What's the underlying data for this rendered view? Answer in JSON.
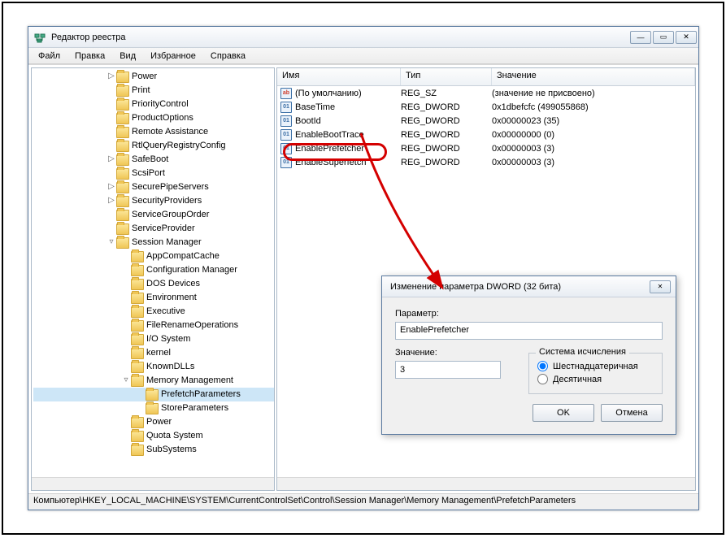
{
  "window": {
    "title": "Редактор реестра",
    "menu": [
      "Файл",
      "Правка",
      "Вид",
      "Избранное",
      "Справка"
    ],
    "btn_min": "—",
    "btn_max": "▭",
    "btn_close": "✕"
  },
  "tree": [
    {
      "ind": 90,
      "exp": "▷",
      "label": "Power"
    },
    {
      "ind": 90,
      "exp": "",
      "label": "Print"
    },
    {
      "ind": 90,
      "exp": "",
      "label": "PriorityControl"
    },
    {
      "ind": 90,
      "exp": "",
      "label": "ProductOptions"
    },
    {
      "ind": 90,
      "exp": "",
      "label": "Remote Assistance"
    },
    {
      "ind": 90,
      "exp": "",
      "label": "RtlQueryRegistryConfig"
    },
    {
      "ind": 90,
      "exp": "▷",
      "label": "SafeBoot"
    },
    {
      "ind": 90,
      "exp": "",
      "label": "ScsiPort"
    },
    {
      "ind": 90,
      "exp": "▷",
      "label": "SecurePipeServers"
    },
    {
      "ind": 90,
      "exp": "▷",
      "label": "SecurityProviders"
    },
    {
      "ind": 90,
      "exp": "",
      "label": "ServiceGroupOrder"
    },
    {
      "ind": 90,
      "exp": "",
      "label": "ServiceProvider"
    },
    {
      "ind": 90,
      "exp": "▿",
      "label": "Session Manager"
    },
    {
      "ind": 108,
      "exp": "",
      "label": "AppCompatCache"
    },
    {
      "ind": 108,
      "exp": "",
      "label": "Configuration Manager"
    },
    {
      "ind": 108,
      "exp": "",
      "label": "DOS Devices"
    },
    {
      "ind": 108,
      "exp": "",
      "label": "Environment"
    },
    {
      "ind": 108,
      "exp": "",
      "label": "Executive"
    },
    {
      "ind": 108,
      "exp": "",
      "label": "FileRenameOperations"
    },
    {
      "ind": 108,
      "exp": "",
      "label": "I/O System"
    },
    {
      "ind": 108,
      "exp": "",
      "label": "kernel"
    },
    {
      "ind": 108,
      "exp": "",
      "label": "KnownDLLs"
    },
    {
      "ind": 108,
      "exp": "▿",
      "label": "Memory Management"
    },
    {
      "ind": 126,
      "exp": "",
      "label": "PrefetchParameters",
      "sel": true
    },
    {
      "ind": 126,
      "exp": "",
      "label": "StoreParameters"
    },
    {
      "ind": 108,
      "exp": "",
      "label": "Power"
    },
    {
      "ind": 108,
      "exp": "",
      "label": "Quota System"
    },
    {
      "ind": 108,
      "exp": "",
      "label": "SubSystems"
    }
  ],
  "columns": {
    "name": "Имя",
    "type": "Тип",
    "value": "Значение"
  },
  "values": [
    {
      "ic": "ab",
      "name": "(По умолчанию)",
      "type": "REG_SZ",
      "value": "(значение не присвоено)"
    },
    {
      "ic": "01",
      "name": "BaseTime",
      "type": "REG_DWORD",
      "value": "0x1dbefcfc (499055868)"
    },
    {
      "ic": "01",
      "name": "BootId",
      "type": "REG_DWORD",
      "value": "0x00000023 (35)"
    },
    {
      "ic": "01",
      "name": "EnableBootTrace",
      "type": "REG_DWORD",
      "value": "0x00000000 (0)"
    },
    {
      "ic": "01",
      "name": "EnablePrefetcher",
      "type": "REG_DWORD",
      "value": "0x00000003 (3)",
      "hl": true
    },
    {
      "ic": "01",
      "name": "EnableSuperfetch",
      "type": "REG_DWORD",
      "value": "0x00000003 (3)"
    }
  ],
  "dialog": {
    "title": "Изменение параметра DWORD (32 бита)",
    "param_label": "Параметр:",
    "param_value": "EnablePrefetcher",
    "value_label": "Значение:",
    "value_value": "3",
    "radix_label": "Система исчисления",
    "radix_hex": "Шестнадцатеричная",
    "radix_dec": "Десятичная",
    "ok": "OK",
    "cancel": "Отмена",
    "close": "✕"
  },
  "statusbar": "Компьютер\\HKEY_LOCAL_MACHINE\\SYSTEM\\CurrentControlSet\\Control\\Session Manager\\Memory Management\\PrefetchParameters"
}
